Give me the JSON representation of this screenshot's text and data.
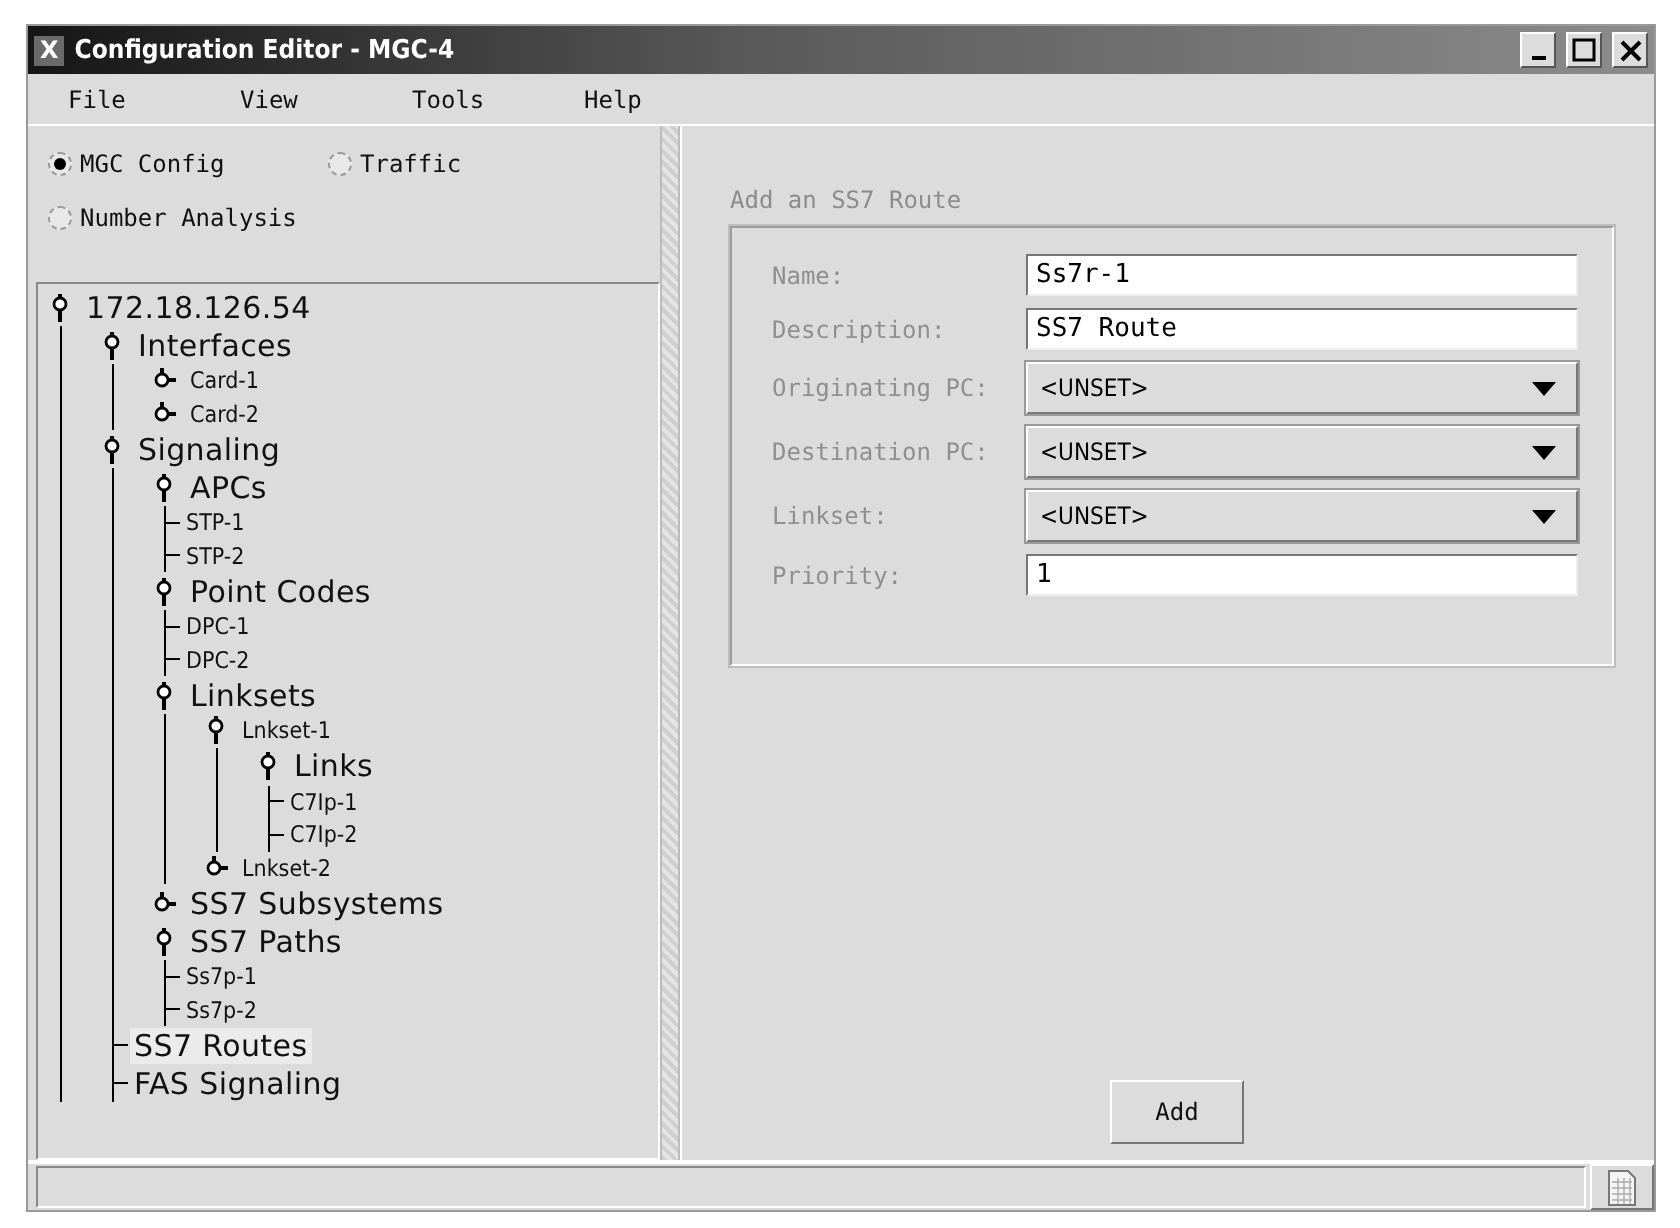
{
  "window": {
    "title": "Configuration Editor - MGC-4",
    "app_icon_letter": "X"
  },
  "menu": [
    "File",
    "View",
    "Tools",
    "Help"
  ],
  "modes": [
    {
      "label": "MGC Config",
      "selected": true
    },
    {
      "label": "Traffic",
      "selected": false
    },
    {
      "label": "Number Analysis",
      "selected": false
    }
  ],
  "tree": [
    {
      "label": "172.18.126.54",
      "kind": "major",
      "selected": false,
      "expanded": true,
      "children": [
        {
          "label": "Interfaces",
          "kind": "major",
          "selected": false,
          "expanded": true,
          "children": [
            {
              "label": "Card-1",
              "kind": "minor",
              "selected": false,
              "expanded": false
            },
            {
              "label": "Card-2",
              "kind": "minor",
              "selected": false,
              "expanded": false
            }
          ]
        },
        {
          "label": "Signaling",
          "kind": "major",
          "selected": false,
          "expanded": true,
          "children": [
            {
              "label": "APCs",
              "kind": "major",
              "selected": false,
              "expanded": true,
              "children": [
                {
                  "label": "STP-1",
                  "kind": "minor",
                  "selected": false
                },
                {
                  "label": "STP-2",
                  "kind": "minor",
                  "selected": false
                }
              ]
            },
            {
              "label": "Point Codes",
              "kind": "major",
              "selected": false,
              "expanded": true,
              "children": [
                {
                  "label": "DPC-1",
                  "kind": "minor",
                  "selected": false
                },
                {
                  "label": "DPC-2",
                  "kind": "minor",
                  "selected": false
                }
              ]
            },
            {
              "label": "Linksets",
              "kind": "major",
              "selected": false,
              "expanded": true,
              "children": [
                {
                  "label": "Lnkset-1",
                  "kind": "minor",
                  "selected": false,
                  "expanded": true,
                  "children": [
                    {
                      "label": "Links",
                      "kind": "major",
                      "selected": false,
                      "expanded": true,
                      "children": [
                        {
                          "label": "C7Ip-1",
                          "kind": "minor",
                          "selected": false
                        },
                        {
                          "label": "C7Ip-2",
                          "kind": "minor",
                          "selected": false
                        }
                      ]
                    }
                  ]
                },
                {
                  "label": "Lnkset-2",
                  "kind": "minor",
                  "selected": false,
                  "expanded": false
                }
              ]
            },
            {
              "label": "SS7 Subsystems",
              "kind": "major",
              "selected": false,
              "expanded": false
            },
            {
              "label": "SS7 Paths",
              "kind": "major",
              "selected": false,
              "expanded": true,
              "children": [
                {
                  "label": "Ss7p-1",
                  "kind": "minor",
                  "selected": false
                },
                {
                  "label": "Ss7p-2",
                  "kind": "minor",
                  "selected": false
                }
              ]
            },
            {
              "label": "SS7 Routes",
              "kind": "major",
              "selected": true
            },
            {
              "label": "FAS Signaling",
              "kind": "major",
              "selected": false
            }
          ]
        }
      ]
    }
  ],
  "form": {
    "title": "Add an SS7 Route",
    "fields": [
      {
        "kind": "text",
        "label": "Name:",
        "value": "Ss7r-1"
      },
      {
        "kind": "text",
        "label": "Description:",
        "value": "SS7 Route"
      },
      {
        "kind": "select",
        "label": "Originating PC:",
        "value": "<UNSET>"
      },
      {
        "kind": "select",
        "label": "Destination PC:",
        "value": "<UNSET>"
      },
      {
        "kind": "select",
        "label": "Linkset:",
        "value": "<UNSET>"
      },
      {
        "kind": "text",
        "label": "Priority:",
        "value": "1"
      }
    ],
    "button": "Add"
  }
}
